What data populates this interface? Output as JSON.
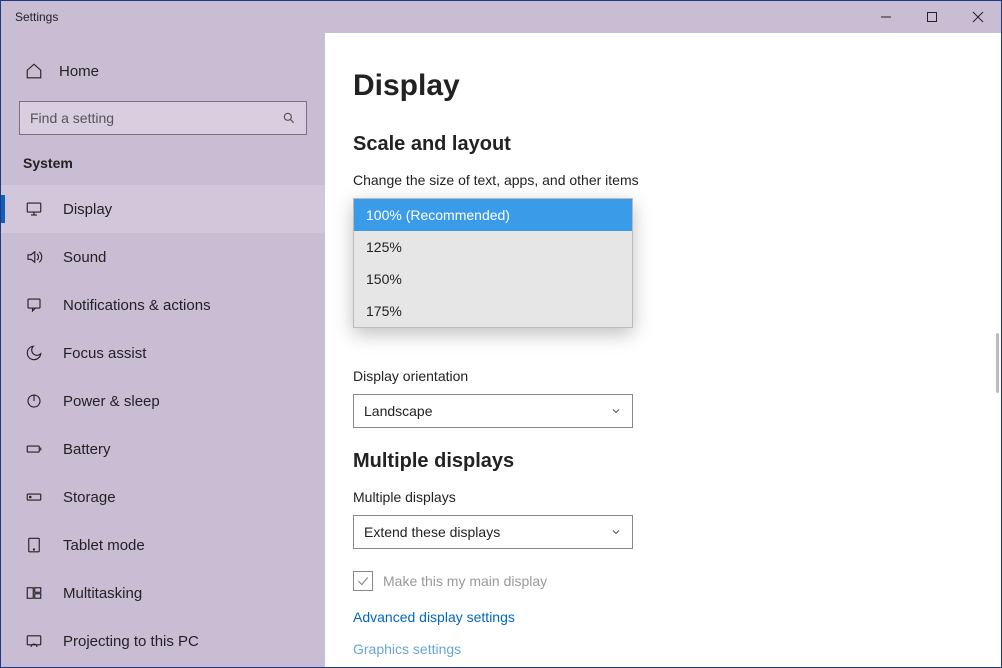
{
  "window": {
    "title": "Settings"
  },
  "sidebar": {
    "home": "Home",
    "search_placeholder": "Find a setting",
    "section": "System",
    "items": [
      {
        "icon": "display-icon",
        "label": "Display",
        "active": true
      },
      {
        "icon": "sound-icon",
        "label": "Sound",
        "active": false
      },
      {
        "icon": "notifications-icon",
        "label": "Notifications & actions",
        "active": false
      },
      {
        "icon": "focus-assist-icon",
        "label": "Focus assist",
        "active": false
      },
      {
        "icon": "power-sleep-icon",
        "label": "Power & sleep",
        "active": false
      },
      {
        "icon": "battery-icon",
        "label": "Battery",
        "active": false
      },
      {
        "icon": "storage-icon",
        "label": "Storage",
        "active": false
      },
      {
        "icon": "tablet-mode-icon",
        "label": "Tablet mode",
        "active": false
      },
      {
        "icon": "multitasking-icon",
        "label": "Multitasking",
        "active": false
      },
      {
        "icon": "projecting-icon",
        "label": "Projecting to this PC",
        "active": false
      }
    ]
  },
  "content": {
    "title": "Display",
    "scale_section": "Scale and layout",
    "scale_label": "Change the size of text, apps, and other items",
    "scale_options": [
      "100% (Recommended)",
      "125%",
      "150%",
      "175%"
    ],
    "scale_selected": "100% (Recommended)",
    "orientation_label": "Display orientation",
    "orientation_value": "Landscape",
    "multi_section": "Multiple displays",
    "multi_label": "Multiple displays",
    "multi_value": "Extend these displays",
    "main_display_check": "Make this my main display",
    "main_display_checked": true,
    "advanced_link": "Advanced display settings",
    "graphics_link": "Graphics settings"
  }
}
